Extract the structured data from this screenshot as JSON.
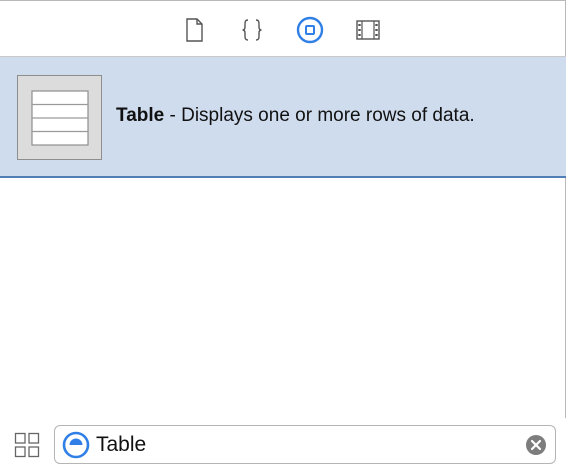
{
  "toolbar": {
    "tabs": [
      {
        "name": "file-template-library",
        "icon": "document-icon",
        "selected": false
      },
      {
        "name": "code-snippet-library",
        "icon": "braces-icon",
        "selected": false
      },
      {
        "name": "object-library",
        "icon": "object-library-icon",
        "selected": true
      },
      {
        "name": "media-library",
        "icon": "film-strip-icon",
        "selected": false
      }
    ],
    "accent_color": "#2f7fe6"
  },
  "object_list": {
    "items": [
      {
        "name": "Table",
        "description": " - Displays one or more rows of data.",
        "icon": "table-thumbnail-icon",
        "selected": true
      }
    ],
    "selection_color": "#cfdcee"
  },
  "filter_bar": {
    "grid_toggle_icon": "grid-view-icon",
    "filter_type_icon": "object-filter-icon",
    "search_value": "Table",
    "clear_icon": "clear-icon"
  }
}
